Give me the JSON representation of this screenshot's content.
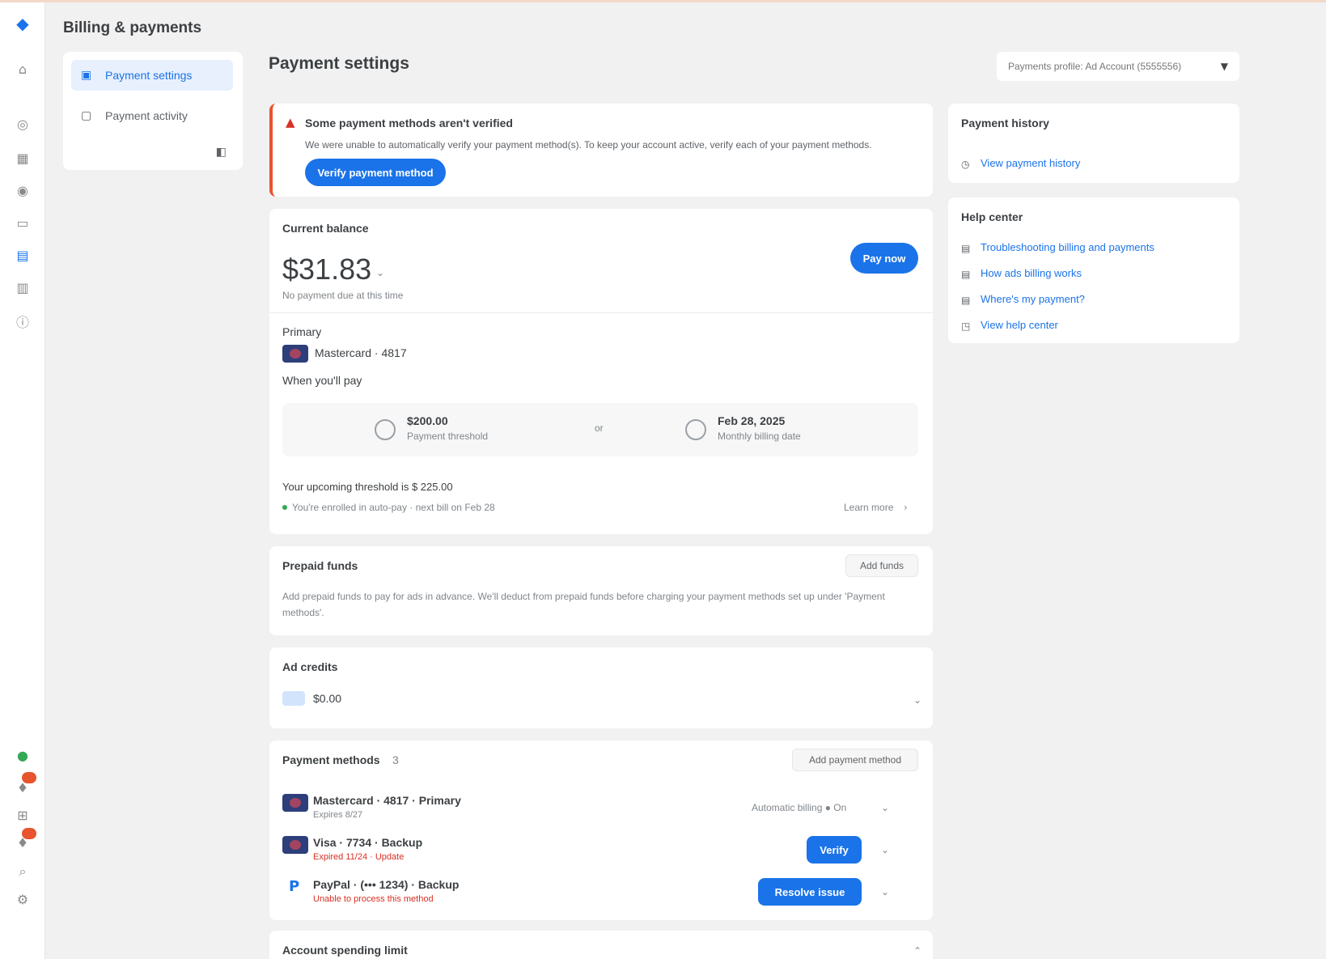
{
  "app": {
    "title": "Billing & payments"
  },
  "rail": {
    "icons": [
      "home-icon",
      "campaigns-icon",
      "goals-icon",
      "tools-icon",
      "billing-icon",
      "admin-icon",
      "help-icon"
    ]
  },
  "leftnav": {
    "items": [
      {
        "label": "Payment settings",
        "icon": "card-icon",
        "active": true
      },
      {
        "label": "Payment activity",
        "icon": "activity-icon",
        "active": false
      }
    ]
  },
  "header": {
    "section_title": "Payment settings",
    "profile_select": "Payments profile: Ad Account (5555556)"
  },
  "alert": {
    "title": "Some payment methods aren't verified",
    "text": "We were unable to automatically verify your payment method(s). To keep your account active, verify each of your payment methods.",
    "button": "Verify payment method"
  },
  "balance": {
    "title": "Current balance",
    "amount": "$31.83",
    "note": "No payment due at this time",
    "pay_button": "Pay now",
    "primary_label": "Primary",
    "primary_card": "Mastercard · 4817",
    "when_label": "When you'll pay",
    "threshold_amount": "$200.00",
    "threshold_sub": "Payment threshold",
    "or": "or",
    "date_value": "Feb 28, 2025",
    "date_sub": "Monthly billing date",
    "upcoming": "Your upcoming threshold is $ 225.00",
    "auto_note": "You're enrolled in auto-pay · next bill on Feb 28",
    "learn_more": "Learn more"
  },
  "prepaid": {
    "title": "Prepaid funds",
    "add_button": "Add funds",
    "text": "Add prepaid funds to pay for ads in advance. We'll deduct from prepaid funds before charging your payment methods set up under 'Payment methods'."
  },
  "adcredits": {
    "title": "Ad credits",
    "item": "$0.00"
  },
  "pmethods": {
    "title": "Payment methods",
    "count": "3",
    "add_button": "Add payment method",
    "rows": [
      {
        "name": "Mastercard · 4817 · Primary",
        "sub": "Expires 8/27",
        "sub_status": "ok",
        "right": "Automatic billing ● On",
        "action": ""
      },
      {
        "name": "Visa · 7734 · Backup",
        "sub": "Expired 11/24 · Update",
        "sub_status": "error",
        "right": "",
        "action": "Verify"
      },
      {
        "name": "PayPal · (••• 1234) · Backup",
        "sub": "Unable to process this method",
        "sub_status": "error",
        "right": "",
        "action": "Resolve issue"
      }
    ]
  },
  "spending": {
    "title": "Account spending limit"
  },
  "history": {
    "title": "Payment history",
    "link": "View payment history"
  },
  "help": {
    "title": "Help center",
    "links": [
      "Troubleshooting billing and payments",
      "How ads billing works",
      "Where's my payment?",
      "View help center"
    ]
  },
  "colors": {
    "accent": "#1a73e8",
    "alert": "#e8542e",
    "error": "#d93025",
    "success": "#34a853"
  }
}
